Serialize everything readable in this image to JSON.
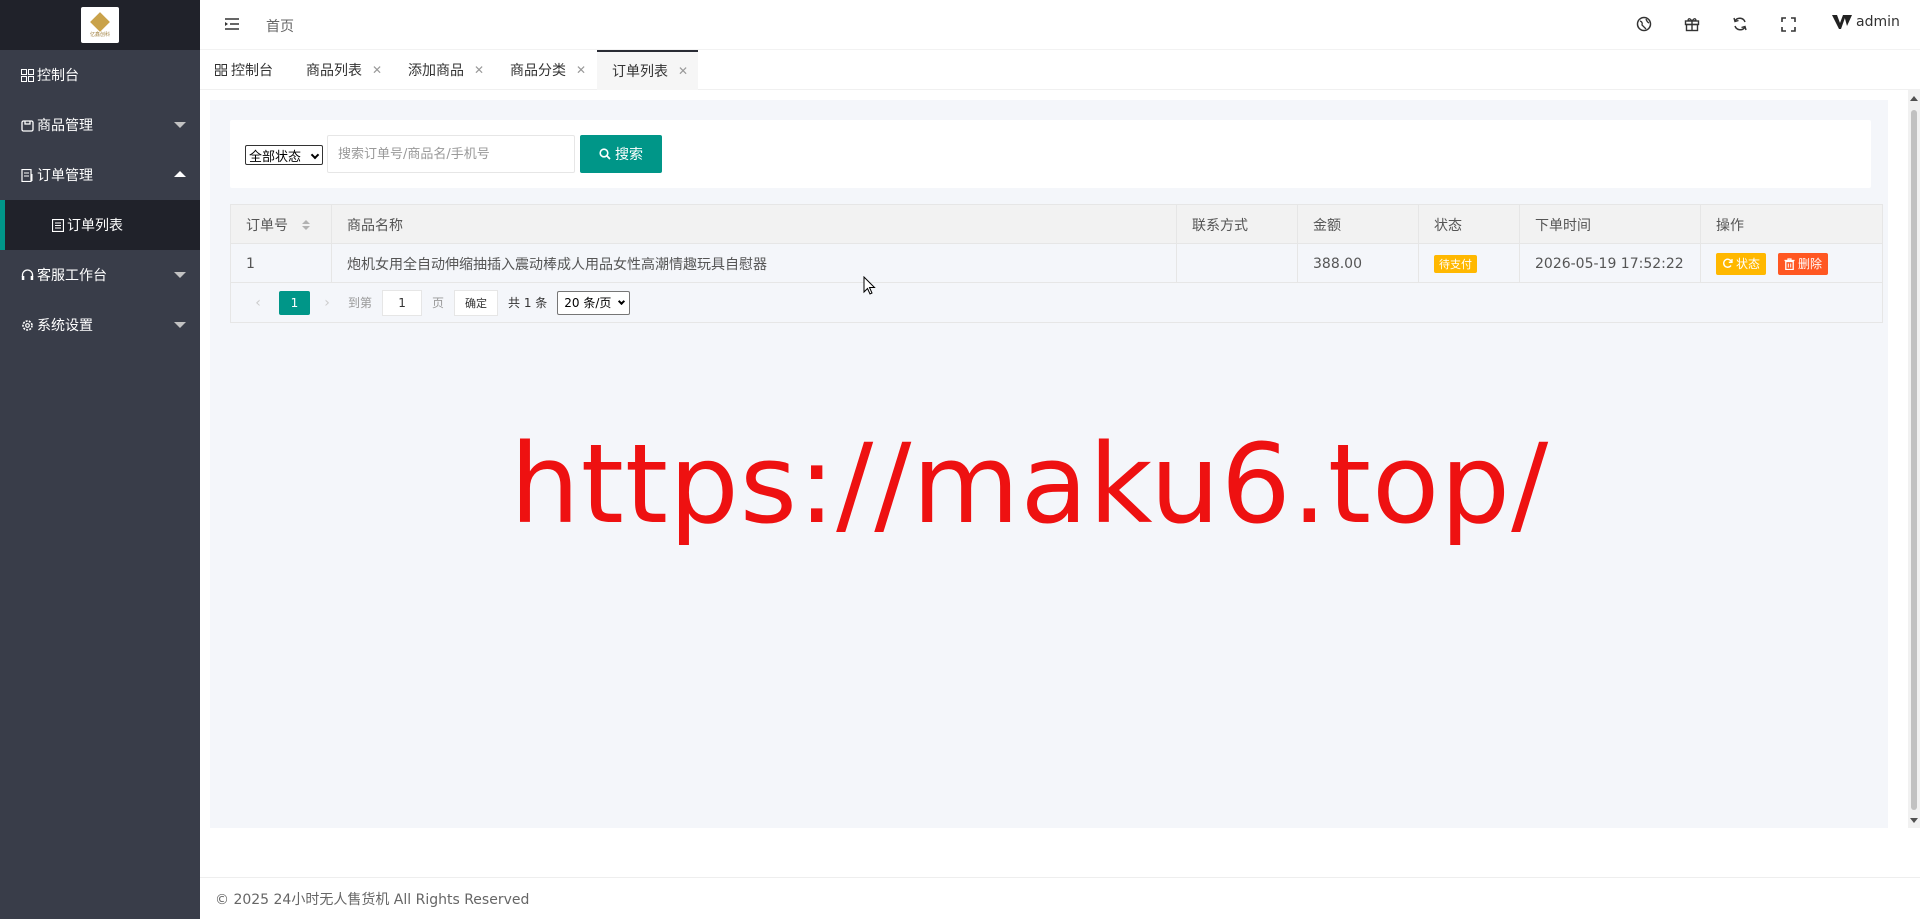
{
  "sidebar": {
    "logo_text": "亿鑫创科",
    "items": [
      {
        "label": "控制台",
        "icon": "dashboard-icon"
      },
      {
        "label": "商品管理",
        "icon": "product-icon"
      },
      {
        "label": "订单管理",
        "icon": "order-icon"
      },
      {
        "label": "订单列表",
        "icon": "list-icon"
      },
      {
        "label": "客服工作台",
        "icon": "headset-icon"
      },
      {
        "label": "系统设置",
        "icon": "gear-icon"
      }
    ]
  },
  "header": {
    "breadcrumb": "首页",
    "username": "admin",
    "icons": [
      "globe-icon",
      "gift-icon",
      "refresh-icon",
      "fullscreen-icon"
    ]
  },
  "tabs": [
    {
      "label": "控制台"
    },
    {
      "label": "商品列表"
    },
    {
      "label": "添加商品"
    },
    {
      "label": "商品分类"
    },
    {
      "label": "订单列表"
    }
  ],
  "search": {
    "status_value": "全部状态",
    "placeholder": "搜索订单号/商品名/手机号",
    "button_label": "搜索"
  },
  "table": {
    "columns": [
      "订单号",
      "商品名称",
      "联系方式",
      "金额",
      "状态",
      "下单时间",
      "操作"
    ],
    "rows": [
      {
        "id": "1",
        "product": "炮机女用全自动伸缩抽插入震动棒成人用品女性高潮情趣玩具自慰器",
        "contact": "",
        "amount": "388.00",
        "status": "待支付",
        "time": "2026-05-19 17:52:22",
        "op_status": "状态",
        "op_delete": "删除"
      }
    ]
  },
  "pager": {
    "current": "1",
    "goto_prefix": "到第",
    "goto_value": "1",
    "goto_suffix": "页",
    "confirm": "确定",
    "total": "共 1 条",
    "page_size": "20 条/页"
  },
  "watermark": "https://maku6.top/",
  "footer": "© 2025 24小时无人售货机 All Rights Reserved",
  "colors": {
    "sidebar_bg": "#393d49",
    "accent": "#009688",
    "warning": "#ffb800",
    "danger": "#ff5722",
    "watermark": "#ee1111"
  }
}
